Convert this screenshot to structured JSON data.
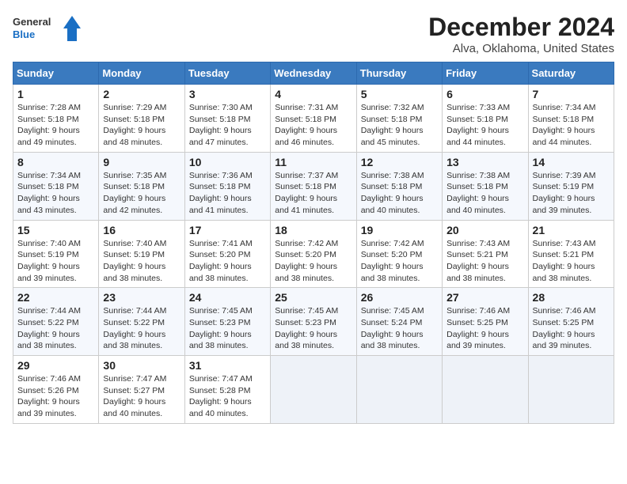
{
  "logo": {
    "line1": "General",
    "line2": "Blue"
  },
  "title": "December 2024",
  "subtitle": "Alva, Oklahoma, United States",
  "days_header": [
    "Sunday",
    "Monday",
    "Tuesday",
    "Wednesday",
    "Thursday",
    "Friday",
    "Saturday"
  ],
  "weeks": [
    [
      {
        "day": "1",
        "info": "Sunrise: 7:28 AM\nSunset: 5:18 PM\nDaylight: 9 hours\nand 49 minutes."
      },
      {
        "day": "2",
        "info": "Sunrise: 7:29 AM\nSunset: 5:18 PM\nDaylight: 9 hours\nand 48 minutes."
      },
      {
        "day": "3",
        "info": "Sunrise: 7:30 AM\nSunset: 5:18 PM\nDaylight: 9 hours\nand 47 minutes."
      },
      {
        "day": "4",
        "info": "Sunrise: 7:31 AM\nSunset: 5:18 PM\nDaylight: 9 hours\nand 46 minutes."
      },
      {
        "day": "5",
        "info": "Sunrise: 7:32 AM\nSunset: 5:18 PM\nDaylight: 9 hours\nand 45 minutes."
      },
      {
        "day": "6",
        "info": "Sunrise: 7:33 AM\nSunset: 5:18 PM\nDaylight: 9 hours\nand 44 minutes."
      },
      {
        "day": "7",
        "info": "Sunrise: 7:34 AM\nSunset: 5:18 PM\nDaylight: 9 hours\nand 44 minutes."
      }
    ],
    [
      {
        "day": "8",
        "info": "Sunrise: 7:34 AM\nSunset: 5:18 PM\nDaylight: 9 hours\nand 43 minutes."
      },
      {
        "day": "9",
        "info": "Sunrise: 7:35 AM\nSunset: 5:18 PM\nDaylight: 9 hours\nand 42 minutes."
      },
      {
        "day": "10",
        "info": "Sunrise: 7:36 AM\nSunset: 5:18 PM\nDaylight: 9 hours\nand 41 minutes."
      },
      {
        "day": "11",
        "info": "Sunrise: 7:37 AM\nSunset: 5:18 PM\nDaylight: 9 hours\nand 41 minutes."
      },
      {
        "day": "12",
        "info": "Sunrise: 7:38 AM\nSunset: 5:18 PM\nDaylight: 9 hours\nand 40 minutes."
      },
      {
        "day": "13",
        "info": "Sunrise: 7:38 AM\nSunset: 5:18 PM\nDaylight: 9 hours\nand 40 minutes."
      },
      {
        "day": "14",
        "info": "Sunrise: 7:39 AM\nSunset: 5:19 PM\nDaylight: 9 hours\nand 39 minutes."
      }
    ],
    [
      {
        "day": "15",
        "info": "Sunrise: 7:40 AM\nSunset: 5:19 PM\nDaylight: 9 hours\nand 39 minutes."
      },
      {
        "day": "16",
        "info": "Sunrise: 7:40 AM\nSunset: 5:19 PM\nDaylight: 9 hours\nand 38 minutes."
      },
      {
        "day": "17",
        "info": "Sunrise: 7:41 AM\nSunset: 5:20 PM\nDaylight: 9 hours\nand 38 minutes."
      },
      {
        "day": "18",
        "info": "Sunrise: 7:42 AM\nSunset: 5:20 PM\nDaylight: 9 hours\nand 38 minutes."
      },
      {
        "day": "19",
        "info": "Sunrise: 7:42 AM\nSunset: 5:20 PM\nDaylight: 9 hours\nand 38 minutes."
      },
      {
        "day": "20",
        "info": "Sunrise: 7:43 AM\nSunset: 5:21 PM\nDaylight: 9 hours\nand 38 minutes."
      },
      {
        "day": "21",
        "info": "Sunrise: 7:43 AM\nSunset: 5:21 PM\nDaylight: 9 hours\nand 38 minutes."
      }
    ],
    [
      {
        "day": "22",
        "info": "Sunrise: 7:44 AM\nSunset: 5:22 PM\nDaylight: 9 hours\nand 38 minutes."
      },
      {
        "day": "23",
        "info": "Sunrise: 7:44 AM\nSunset: 5:22 PM\nDaylight: 9 hours\nand 38 minutes."
      },
      {
        "day": "24",
        "info": "Sunrise: 7:45 AM\nSunset: 5:23 PM\nDaylight: 9 hours\nand 38 minutes."
      },
      {
        "day": "25",
        "info": "Sunrise: 7:45 AM\nSunset: 5:23 PM\nDaylight: 9 hours\nand 38 minutes."
      },
      {
        "day": "26",
        "info": "Sunrise: 7:45 AM\nSunset: 5:24 PM\nDaylight: 9 hours\nand 38 minutes."
      },
      {
        "day": "27",
        "info": "Sunrise: 7:46 AM\nSunset: 5:25 PM\nDaylight: 9 hours\nand 39 minutes."
      },
      {
        "day": "28",
        "info": "Sunrise: 7:46 AM\nSunset: 5:25 PM\nDaylight: 9 hours\nand 39 minutes."
      }
    ],
    [
      {
        "day": "29",
        "info": "Sunrise: 7:46 AM\nSunset: 5:26 PM\nDaylight: 9 hours\nand 39 minutes."
      },
      {
        "day": "30",
        "info": "Sunrise: 7:47 AM\nSunset: 5:27 PM\nDaylight: 9 hours\nand 40 minutes."
      },
      {
        "day": "31",
        "info": "Sunrise: 7:47 AM\nSunset: 5:28 PM\nDaylight: 9 hours\nand 40 minutes."
      },
      null,
      null,
      null,
      null
    ]
  ]
}
